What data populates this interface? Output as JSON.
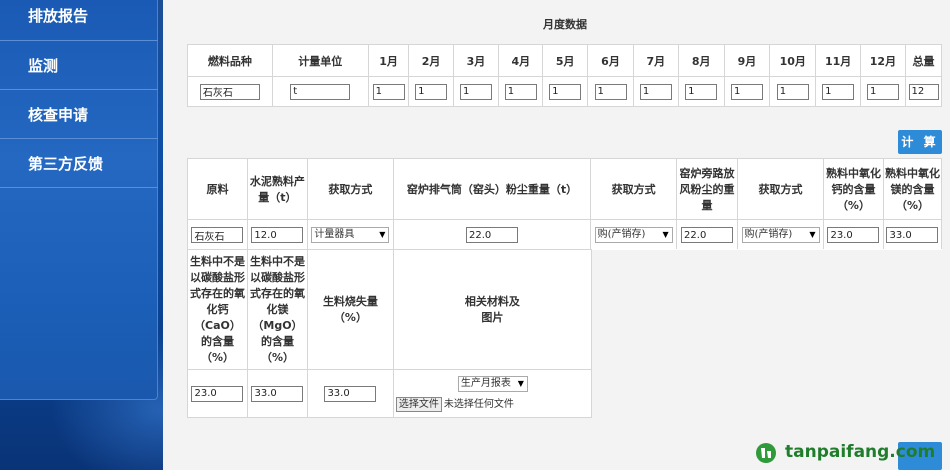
{
  "sidebar": {
    "items": [
      {
        "label": "排放报告"
      },
      {
        "label": "监测"
      },
      {
        "label": "核查申请"
      },
      {
        "label": "第三方反馈"
      }
    ]
  },
  "monthly": {
    "title": "月度数据",
    "headers": [
      "燃料品种",
      "计量单位",
      "1月",
      "2月",
      "3月",
      "4月",
      "5月",
      "6月",
      "7月",
      "8月",
      "9月",
      "10月",
      "11月",
      "12月",
      "总量"
    ],
    "values": [
      "石灰石",
      "t",
      "1",
      "1",
      "1",
      "1",
      "1",
      "1",
      "1",
      "1",
      "1",
      "1",
      "1",
      "1",
      "12"
    ]
  },
  "calc_button": "计 算",
  "table2": {
    "headers": [
      "原料",
      "水泥熟料产量（t）",
      "获取方式",
      "窑炉排气筒（窑头）粉尘重量（t）",
      "获取方式",
      "窑炉旁路放风粉尘的重量",
      "获取方式",
      "熟料中氧化钙的含量（%）",
      "熟料中氧化镁的含量（%）"
    ],
    "values": {
      "raw": "石灰石",
      "clinker": "12.0",
      "method1": "计量器具",
      "dust_kiln": "22.0",
      "method2": "购(产销存)",
      "bypass": "22.0",
      "method3": "购(产销存)",
      "cao": "23.0",
      "mgo": "33.0"
    }
  },
  "table3": {
    "headers": [
      "生料中不是以碳酸盐形式存在的氧化钙（CaO）的含量（%）",
      "生料中不是以碳酸盐形式存在的氧化镁（MgO）的含量（%）",
      "生料烧失量（%）",
      "相关材料及图片"
    ],
    "values": {
      "cao_raw": "23.0",
      "mgo_raw": "33.0",
      "loss": "33.0",
      "doc_type": "生产月报表",
      "file_btn": "选择文件",
      "no_file": "未选择任何文件"
    }
  },
  "watermark": "tanpaifang.com",
  "colors": {
    "accent": "#2e8bd8",
    "sidebar": "#1a5ab4",
    "watermark": "#1f7d2c"
  }
}
